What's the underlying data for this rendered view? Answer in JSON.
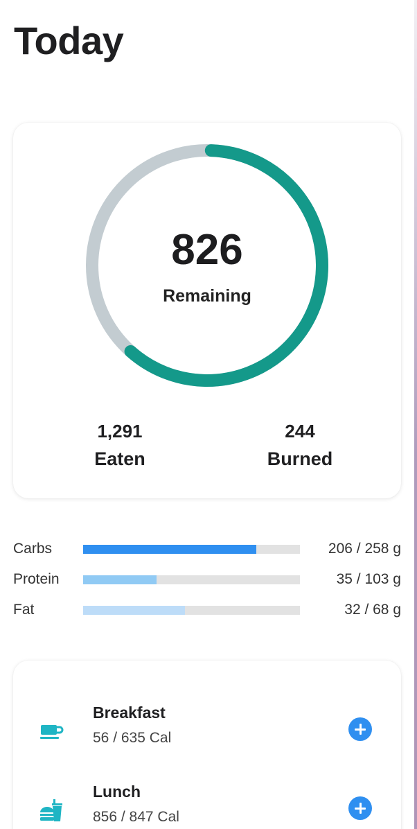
{
  "page": {
    "title": "Today"
  },
  "summary": {
    "remaining_value": "826",
    "remaining_label": "Remaining",
    "progress_fraction": 0.61,
    "eaten_value": "1,291",
    "eaten_label": "Eaten",
    "burned_value": "244",
    "burned_label": "Burned",
    "colors": {
      "progress": "#14998a",
      "track": "#c3ccd1"
    }
  },
  "macros": [
    {
      "name": "Carbs",
      "amount": "206 / 258 g",
      "fraction": 0.8,
      "color": "#2f8ff0"
    },
    {
      "name": "Protein",
      "amount": "35 / 103 g",
      "fraction": 0.34,
      "color": "#90caf4"
    },
    {
      "name": "Fat",
      "amount": "32 / 68 g",
      "fraction": 0.47,
      "color": "#bddcf8"
    }
  ],
  "meals": [
    {
      "name": "Breakfast",
      "calories": "56 / 635 Cal",
      "icon": "coffee-cup-icon"
    },
    {
      "name": "Lunch",
      "calories": "856 / 847 Cal",
      "icon": "burger-drink-icon"
    }
  ],
  "colors": {
    "accent": "#2f8ff0",
    "meal_icon": "#1fb5c4"
  }
}
